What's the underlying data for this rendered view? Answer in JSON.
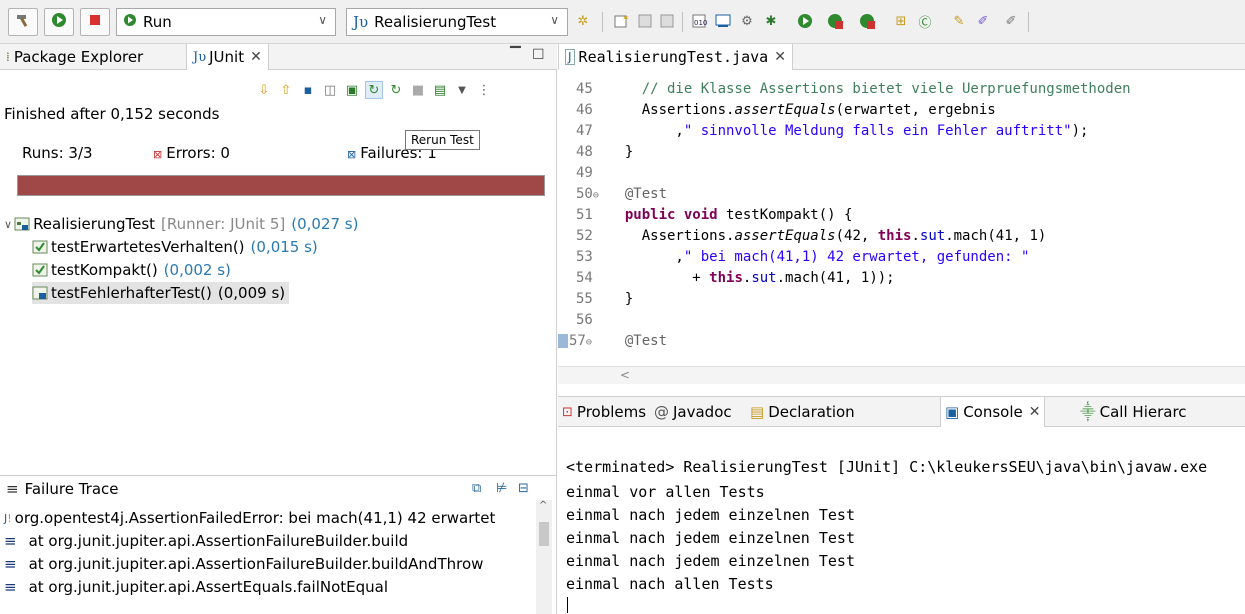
{
  "toolbar": {
    "run_label": "Run",
    "config_label": "RealisierungTest",
    "config_prefix": "Jυ"
  },
  "left_tabs": {
    "package_explorer": "Package Explorer",
    "junit": "JUnit"
  },
  "junit": {
    "finished": "Finished after 0,152 seconds",
    "runs": "Runs: 3/3",
    "errors": "Errors: 0",
    "failures": "Failures: 1",
    "tooltip": "Rerun Test",
    "root": {
      "name": "RealisierungTest",
      "runner": "[Runner: JUnit 5]",
      "time": "(0,027 s)"
    },
    "tests": [
      {
        "name": "testErwartetesVerhalten()",
        "time": "(0,015 s)"
      },
      {
        "name": "testKompakt()",
        "time": "(0,002 s)"
      },
      {
        "name": "testFehlerhafterTest()",
        "time": "(0,009 s)"
      }
    ]
  },
  "failure_trace": {
    "title": "Failure Trace",
    "lines": [
      "org.opentest4j.AssertionFailedError:  bei mach(41,1) 42 erwartet",
      "at org.junit.jupiter.api.AssertionFailureBuilder.build",
      "at org.junit.jupiter.api.AssertionFailureBuilder.buildAndThrow",
      "at org.junit.jupiter.api.AssertEquals.failNotEqual"
    ]
  },
  "editor": {
    "tab": "RealisierungTest.java",
    "lines": [
      {
        "n": "45",
        "t": "    // die Klasse Assertions bietet viele Uerpruefungsmethoden"
      },
      {
        "n": "46",
        "t": "    Assertions.assertEquals(erwartet, ergebnis"
      },
      {
        "n": "47",
        "t": "        ,\" sinnvolle Meldung falls ein Fehler auftritt\");"
      },
      {
        "n": "48",
        "t": "  }"
      },
      {
        "n": "49",
        "t": ""
      },
      {
        "n": "50",
        "t": "  @Test"
      },
      {
        "n": "51",
        "t": "  public void testKompakt() {"
      },
      {
        "n": "52",
        "t": "    Assertions.assertEquals(42, this.sut.mach(41, 1)"
      },
      {
        "n": "53",
        "t": "        ,\" bei mach(41,1) 42 erwartet, gefunden: \""
      },
      {
        "n": "54",
        "t": "          + this.sut.mach(41, 1));"
      },
      {
        "n": "55",
        "t": "  }"
      },
      {
        "n": "56",
        "t": ""
      },
      {
        "n": "57",
        "t": "  @Test"
      }
    ]
  },
  "console_tabs": {
    "problems": "Problems",
    "javadoc": "Javadoc",
    "declaration": "Declaration",
    "console": "Console",
    "call_hierarchy": "Call Hierarc"
  },
  "console": {
    "header": "<terminated> RealisierungTest [JUnit] C:\\kleukersSEU\\java\\bin\\javaw.exe",
    "lines": [
      "einmal vor allen Tests",
      "einmal nach jedem einzelnen Test",
      "einmal nach jedem einzelnen Test",
      "einmal nach jedem einzelnen Test",
      "einmal nach allen Tests"
    ]
  },
  "colors": {
    "failure_bar": "#a04848",
    "keyword": "#7f0055",
    "string": "#2a00ff",
    "comment": "#3f7f5f",
    "time": "#2a7ab0"
  }
}
